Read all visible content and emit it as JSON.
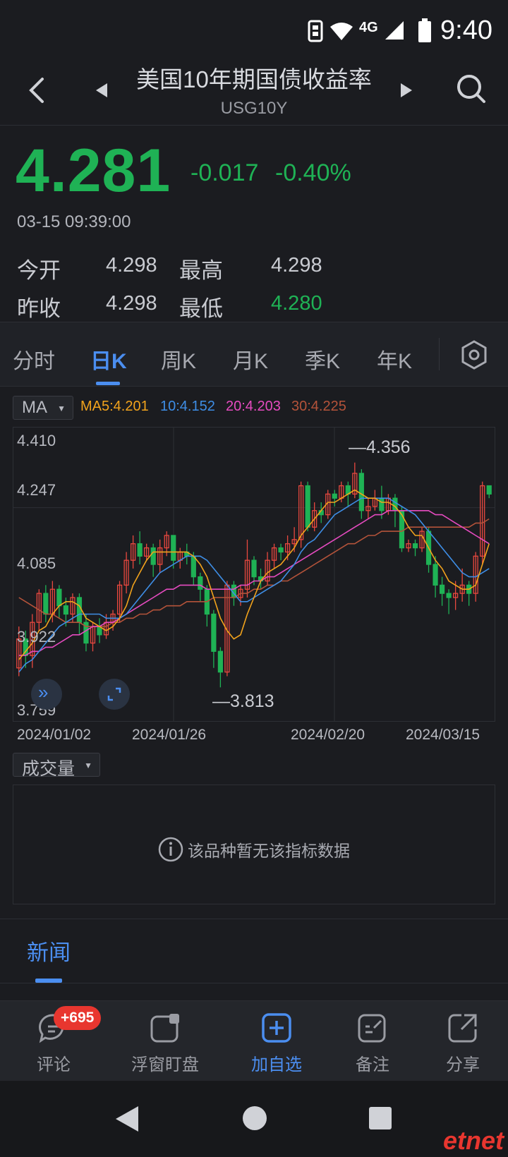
{
  "status": {
    "network": "4G",
    "time": "9:40"
  },
  "header": {
    "title": "美国10年期国债收益率",
    "symbol": "USG10Y"
  },
  "quote": {
    "price": "4.281",
    "change": "-0.017",
    "change_pct": "-0.40%",
    "timestamp": "03-15 09:39:00",
    "open_label": "今开",
    "open": "4.298",
    "high_label": "最高",
    "high": "4.298",
    "prev_close_label": "昨收",
    "prev_close": "4.298",
    "low_label": "最低",
    "low": "4.280"
  },
  "tabs": [
    "分时",
    "日K",
    "周K",
    "月K",
    "季K",
    "年K"
  ],
  "active_tab": "日K",
  "indicator": {
    "selector": "MA",
    "ma5": "MA5:4.201",
    "ma10": "10:4.152",
    "ma20": "20:4.203",
    "ma30": "30:4.225"
  },
  "colors": {
    "up": "#e8483f",
    "down": "#1fb255",
    "ma5": "#f2a31c",
    "ma10": "#3e8ee6",
    "ma20": "#e64bc0",
    "ma30": "#b4533a",
    "accent": "#4b8ef0"
  },
  "chart_data": {
    "type": "candlestick",
    "y_ticks": [
      "4.410",
      "4.247",
      "4.085",
      "3.922",
      "3.759"
    ],
    "ylim": [
      3.759,
      4.41
    ],
    "x_ticks": [
      "2024/01/02",
      "2024/01/26",
      "2024/02/20",
      "2024/03/15"
    ],
    "annotations": {
      "max": "4.356",
      "min": "3.813"
    },
    "candles": [
      [
        3.86,
        3.93,
        3.84,
        3.96
      ],
      [
        3.93,
        3.89,
        3.86,
        3.95
      ],
      [
        3.89,
        3.97,
        3.86,
        3.99
      ],
      [
        3.97,
        4.04,
        3.95,
        4.05
      ],
      [
        4.04,
        3.99,
        3.97,
        4.06
      ],
      [
        3.99,
        4.05,
        3.97,
        4.07
      ],
      [
        4.05,
        4.01,
        3.98,
        4.06
      ],
      [
        4.01,
        3.99,
        3.96,
        4.03
      ],
      [
        3.99,
        4.03,
        3.97,
        4.04
      ],
      [
        4.03,
        3.97,
        3.94,
        4.04
      ],
      [
        3.97,
        3.92,
        3.9,
        3.99
      ],
      [
        3.92,
        3.96,
        3.9,
        3.97
      ],
      [
        3.96,
        3.94,
        3.92,
        3.98
      ],
      [
        3.94,
        3.97,
        3.93,
        3.99
      ],
      [
        3.97,
        3.99,
        3.95,
        4.0
      ],
      [
        3.99,
        4.06,
        3.97,
        4.07
      ],
      [
        4.06,
        4.12,
        4.04,
        4.14
      ],
      [
        4.12,
        4.16,
        4.1,
        4.18
      ],
      [
        4.16,
        4.13,
        4.11,
        4.19
      ],
      [
        4.13,
        4.15,
        4.12,
        4.16
      ],
      [
        4.15,
        4.11,
        4.08,
        4.16
      ],
      [
        4.11,
        4.15,
        4.09,
        4.17
      ],
      [
        4.15,
        4.18,
        4.13,
        4.19
      ],
      [
        4.18,
        4.12,
        4.1,
        4.18
      ],
      [
        4.12,
        4.14,
        4.1,
        4.15
      ],
      [
        4.14,
        4.13,
        4.11,
        4.16
      ],
      [
        4.13,
        4.08,
        4.06,
        4.14
      ],
      [
        4.08,
        4.05,
        4.02,
        4.09
      ],
      [
        4.05,
        3.99,
        3.96,
        4.06
      ],
      [
        3.99,
        3.9,
        3.86,
        4.0
      ],
      [
        3.9,
        3.85,
        3.813,
        3.91
      ],
      [
        3.85,
        4.06,
        3.84,
        4.07
      ],
      [
        4.06,
        4.03,
        4.01,
        4.07
      ],
      [
        4.03,
        4.05,
        4.01,
        4.06
      ],
      [
        4.05,
        4.12,
        4.03,
        4.17
      ],
      [
        4.12,
        4.08,
        4.06,
        4.13
      ],
      [
        4.08,
        4.07,
        4.05,
        4.1
      ],
      [
        4.07,
        4.12,
        4.06,
        4.14
      ],
      [
        4.12,
        4.15,
        4.1,
        4.16
      ],
      [
        4.15,
        4.14,
        4.12,
        4.16
      ],
      [
        4.14,
        4.16,
        4.12,
        4.18
      ],
      [
        4.16,
        4.17,
        4.14,
        4.2
      ],
      [
        4.17,
        4.3,
        4.15,
        4.31
      ],
      [
        4.3,
        4.2,
        4.19,
        4.31
      ],
      [
        4.2,
        4.24,
        4.19,
        4.26
      ],
      [
        4.24,
        4.23,
        4.21,
        4.26
      ],
      [
        4.23,
        4.28,
        4.22,
        4.29
      ],
      [
        4.28,
        4.27,
        4.25,
        4.29
      ],
      [
        4.27,
        4.3,
        4.26,
        4.31
      ],
      [
        4.3,
        4.28,
        4.25,
        4.31
      ],
      [
        4.28,
        4.33,
        4.27,
        4.356
      ],
      [
        4.33,
        4.24,
        4.22,
        4.34
      ],
      [
        4.24,
        4.25,
        4.22,
        4.27
      ],
      [
        4.25,
        4.27,
        4.24,
        4.29
      ],
      [
        4.27,
        4.24,
        4.22,
        4.3
      ],
      [
        4.24,
        4.27,
        4.23,
        4.28
      ],
      [
        4.27,
        4.24,
        4.2,
        4.28
      ],
      [
        4.24,
        4.15,
        4.14,
        4.25
      ],
      [
        4.15,
        4.16,
        4.14,
        4.17
      ],
      [
        4.16,
        4.15,
        4.13,
        4.17
      ],
      [
        4.15,
        4.19,
        4.14,
        4.2
      ],
      [
        4.19,
        4.11,
        4.09,
        4.2
      ],
      [
        4.11,
        4.06,
        4.03,
        4.13
      ],
      [
        4.06,
        4.04,
        4.01,
        4.08
      ],
      [
        4.04,
        4.03,
        3.99,
        4.05
      ],
      [
        4.03,
        4.04,
        4.0,
        4.07
      ],
      [
        4.04,
        4.06,
        4.02,
        4.1
      ],
      [
        4.06,
        4.04,
        4.01,
        4.07
      ],
      [
        4.04,
        4.13,
        4.02,
        4.14
      ],
      [
        4.13,
        4.3,
        4.11,
        4.31
      ],
      [
        4.3,
        4.28,
        4.27,
        4.3
      ]
    ],
    "ma5": [
      3.88,
      3.9,
      3.92,
      3.95,
      3.96,
      3.99,
      4.01,
      4.02,
      4.02,
      4.01,
      3.98,
      3.97,
      3.96,
      3.95,
      3.96,
      3.98,
      4.01,
      4.06,
      4.09,
      4.12,
      4.14,
      4.14,
      4.14,
      4.14,
      4.14,
      4.14,
      4.13,
      4.11,
      4.08,
      4.03,
      3.98,
      3.95,
      3.93,
      3.94,
      3.99,
      4.03,
      4.07,
      4.09,
      4.1,
      4.11,
      4.13,
      4.15,
      4.18,
      4.2,
      4.22,
      4.24,
      4.26,
      4.26,
      4.27,
      4.28,
      4.29,
      4.28,
      4.27,
      4.27,
      4.26,
      4.26,
      4.25,
      4.23,
      4.2,
      4.18,
      4.18,
      4.15,
      4.12,
      4.1,
      4.07,
      4.06,
      4.05,
      4.05,
      4.06,
      4.11,
      4.16
    ],
    "ma10": [
      3.85,
      3.87,
      3.88,
      3.9,
      3.92,
      3.94,
      3.96,
      3.97,
      3.98,
      3.99,
      3.99,
      3.99,
      3.99,
      3.98,
      3.98,
      3.98,
      3.99,
      4.01,
      4.03,
      4.05,
      4.07,
      4.09,
      4.1,
      4.11,
      4.12,
      4.13,
      4.13,
      4.13,
      4.12,
      4.1,
      4.08,
      4.06,
      4.04,
      4.02,
      4.02,
      4.03,
      4.04,
      4.05,
      4.06,
      4.07,
      4.09,
      4.11,
      4.14,
      4.16,
      4.17,
      4.19,
      4.21,
      4.23,
      4.24,
      4.25,
      4.26,
      4.27,
      4.27,
      4.27,
      4.27,
      4.27,
      4.26,
      4.25,
      4.24,
      4.23,
      4.21,
      4.19,
      4.17,
      4.15,
      4.13,
      4.11,
      4.09,
      4.08,
      4.08,
      4.09,
      4.1
    ],
    "ma20": [
      3.89,
      3.89,
      3.9,
      3.9,
      3.91,
      3.91,
      3.92,
      3.93,
      3.94,
      3.94,
      3.95,
      3.96,
      3.96,
      3.97,
      3.97,
      3.98,
      3.99,
      4.0,
      4.01,
      4.02,
      4.03,
      4.04,
      4.05,
      4.05,
      4.06,
      4.06,
      4.06,
      4.06,
      4.05,
      4.05,
      4.05,
      4.05,
      4.05,
      4.06,
      4.06,
      4.07,
      4.07,
      4.08,
      4.08,
      4.09,
      4.1,
      4.11,
      4.12,
      4.13,
      4.14,
      4.15,
      4.16,
      4.17,
      4.18,
      4.19,
      4.2,
      4.21,
      4.22,
      4.23,
      4.23,
      4.24,
      4.24,
      4.24,
      4.24,
      4.24,
      4.24,
      4.24,
      4.23,
      4.23,
      4.22,
      4.21,
      4.2,
      4.19,
      4.18,
      4.17,
      4.16
    ],
    "ma30": [
      4.03,
      4.02,
      4.01,
      4.0,
      3.99,
      3.99,
      3.98,
      3.97,
      3.97,
      3.97,
      3.96,
      3.96,
      3.96,
      3.96,
      3.97,
      3.97,
      3.98,
      3.98,
      3.99,
      3.99,
      4.0,
      4.0,
      4.01,
      4.01,
      4.01,
      4.02,
      4.02,
      4.02,
      4.02,
      4.03,
      4.03,
      4.03,
      4.03,
      4.04,
      4.04,
      4.05,
      4.05,
      4.06,
      4.06,
      4.07,
      4.07,
      4.08,
      4.09,
      4.1,
      4.11,
      4.12,
      4.13,
      4.14,
      4.15,
      4.16,
      4.16,
      4.17,
      4.18,
      4.18,
      4.19,
      4.19,
      4.19,
      4.19,
      4.2,
      4.2,
      4.2,
      4.2,
      4.2,
      4.2,
      4.2,
      4.2,
      4.2,
      4.2,
      4.21,
      4.21,
      4.22
    ]
  },
  "volume": {
    "selector": "成交量",
    "empty_message": "该品种暂无该指标数据"
  },
  "news": {
    "tab": "新闻"
  },
  "bottom_bar": {
    "comments": "评论",
    "comments_badge": "+695",
    "float": "浮窗盯盘",
    "watchlist": "加自选",
    "note": "备注",
    "share": "分享"
  },
  "watermark": "etnet"
}
